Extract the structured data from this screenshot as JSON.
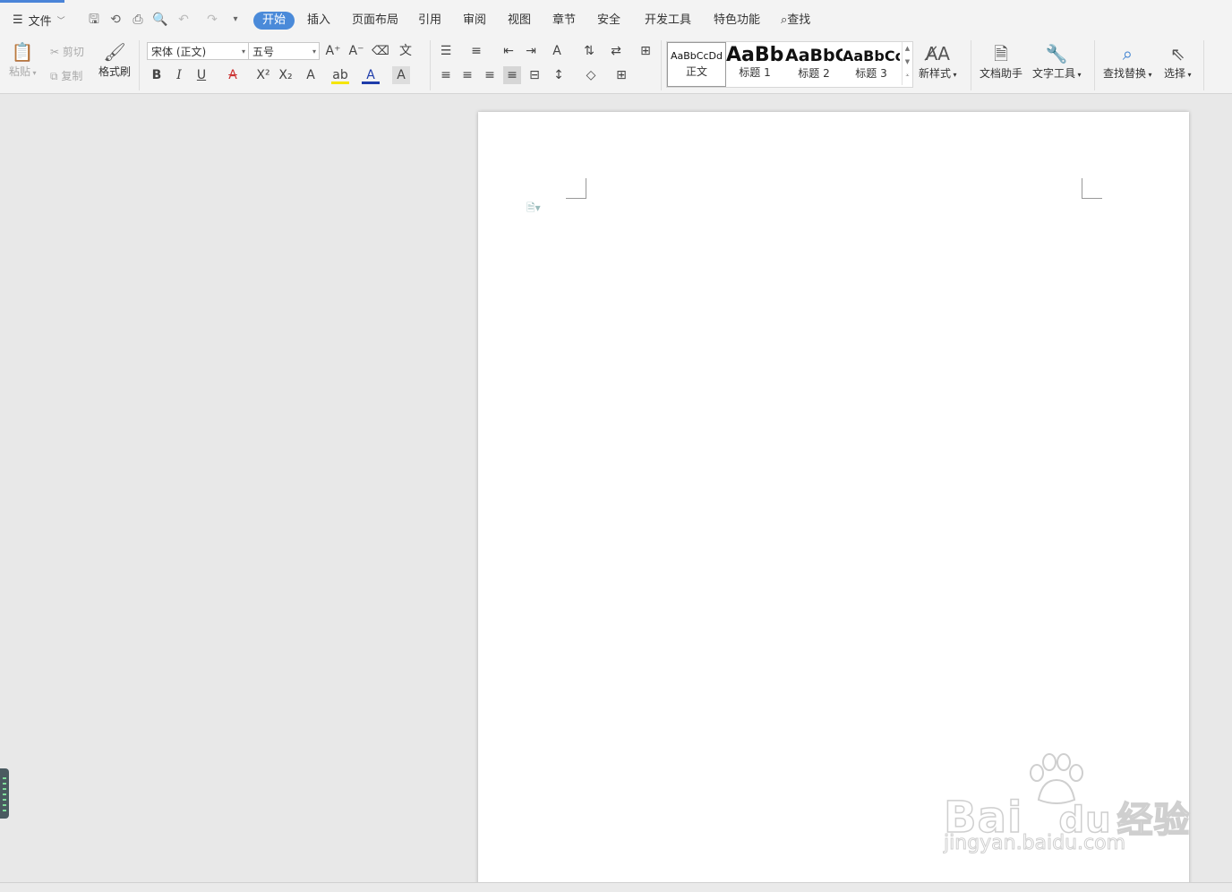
{
  "menu": {
    "file_label": "文件",
    "tabs": [
      "开始",
      "插入",
      "页面布局",
      "引用",
      "审阅",
      "视图",
      "章节",
      "安全",
      "开发工具",
      "特色功能"
    ],
    "active_tab": "开始",
    "search_label": "查找"
  },
  "clipboard": {
    "paste": "粘贴",
    "cut": "剪切",
    "copy": "复制",
    "format_painter": "格式刷"
  },
  "font": {
    "name": "宋体 (正文)",
    "size": "五号"
  },
  "styles": [
    {
      "sample": "AaBbCcDd",
      "name": "正文"
    },
    {
      "sample": "AaBb",
      "name": "标题 1"
    },
    {
      "sample": "AaBbC",
      "name": "标题 2"
    },
    {
      "sample": "AaBbCc",
      "name": "标题 3"
    }
  ],
  "tools": {
    "new_style": "新样式",
    "doc_assistant": "文档助手",
    "text_tools": "文字工具",
    "find_replace": "查找替换",
    "select": "选择"
  },
  "watermark": {
    "brand": "Bai",
    "brand_suffix": "du",
    "cn": "经验",
    "url": "jingyan.baidu.com"
  },
  "colors": {
    "accent": "#4a8ad9",
    "highlight": "#f5e500",
    "font_color": "#1e3caa"
  }
}
